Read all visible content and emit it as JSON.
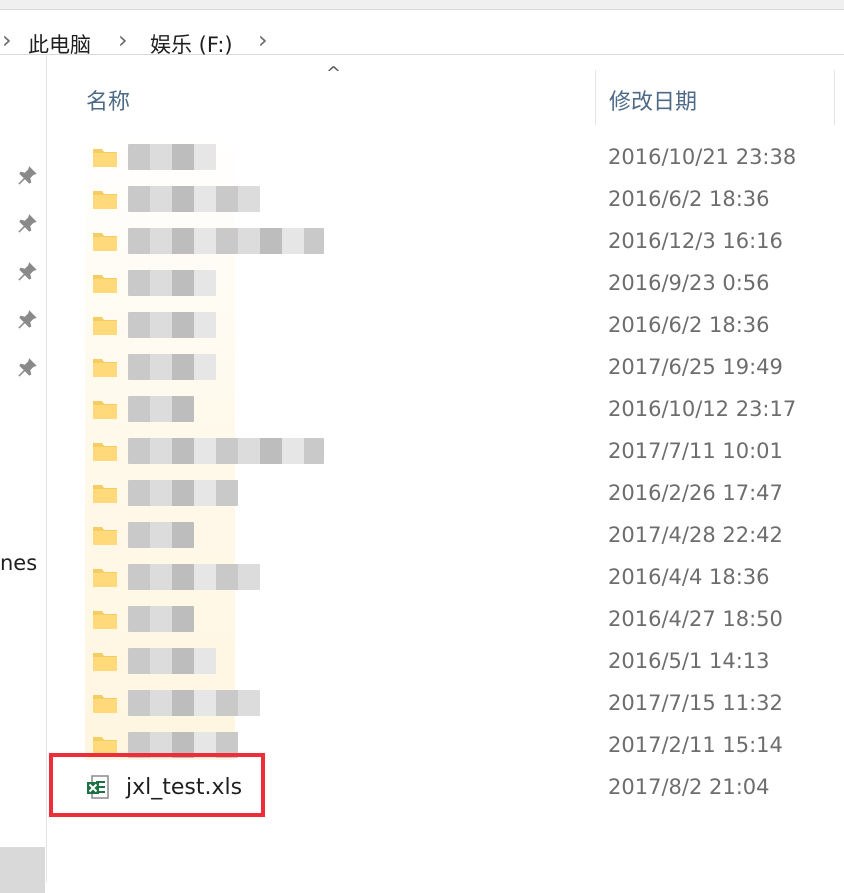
{
  "breadcrumb": {
    "items": [
      "此电脑",
      "娱乐 (F:)"
    ]
  },
  "nav": {
    "partial_label": "nes",
    "pins": [
      "pin-icon",
      "pin-icon",
      "pin-icon",
      "pin-icon",
      "pin-icon"
    ]
  },
  "columns": {
    "name": "名称",
    "date_modified": "修改日期"
  },
  "rows": [
    {
      "date": "2016/10/21 23:38"
    },
    {
      "date": "2016/6/2 18:36"
    },
    {
      "date": "2016/12/3 16:16"
    },
    {
      "date": "2016/9/23 0:56"
    },
    {
      "date": "2016/6/2 18:36"
    },
    {
      "date": "2017/6/25 19:49"
    },
    {
      "date": "2016/10/12 23:17"
    },
    {
      "date": "2017/7/11 10:01"
    },
    {
      "date": "2016/2/26 17:47"
    },
    {
      "date": "2017/4/28 22:42"
    },
    {
      "date": "2016/4/4 18:36"
    },
    {
      "date": "2016/4/27 18:50"
    },
    {
      "date": "2016/5/1 14:13"
    },
    {
      "date": "2017/7/15 11:32"
    },
    {
      "date": "2017/2/11 15:14"
    }
  ],
  "file": {
    "name": "jxl_test.xls",
    "date": "2017/8/2 21:04",
    "icon": "excel-file-icon"
  },
  "colors": {
    "highlight": "#ee2d3a",
    "folder": "#f4cd63",
    "excel": "#1e7145",
    "header_text": "#4d6a87"
  }
}
